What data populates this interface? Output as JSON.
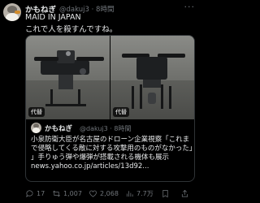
{
  "tweet": {
    "author_name": "かもねぎ",
    "author_handle": "@dakuj3",
    "separator": "·",
    "time": "8時間",
    "more_label": "···",
    "text_line1": "MAID IN JAPAN",
    "text_line2": "これで人を殺すんですね。"
  },
  "quote": {
    "media_label_left": "代替",
    "media_label_right": "代替",
    "author_name": "かもねぎ",
    "author_handle": "@dakuj3",
    "separator": "·",
    "time": "8時間",
    "lines": [
      "小泉防衛大臣が名古屋のドローン企業視察「これま",
      "で侵略してくる敵に対する攻撃用のものがなかった」",
      "」手りゅう弾や爆弾が搭載される機体も展示",
      "news.yahoo.co.jp/articles/13d92..."
    ]
  },
  "actions": {
    "reply_count": "17",
    "retweet_count": "1,007",
    "like_count": "2,068",
    "view_count": "7.7万"
  },
  "icons": {
    "reply": "reply-icon",
    "retweet": "retweet-icon",
    "like": "heart-icon",
    "views": "views-icon",
    "bookmark": "bookmark-icon",
    "share": "share-icon"
  },
  "colors": {
    "background": "#000000",
    "text": "#e7e9ea",
    "muted": "#71767b",
    "border": "#2f3336"
  }
}
